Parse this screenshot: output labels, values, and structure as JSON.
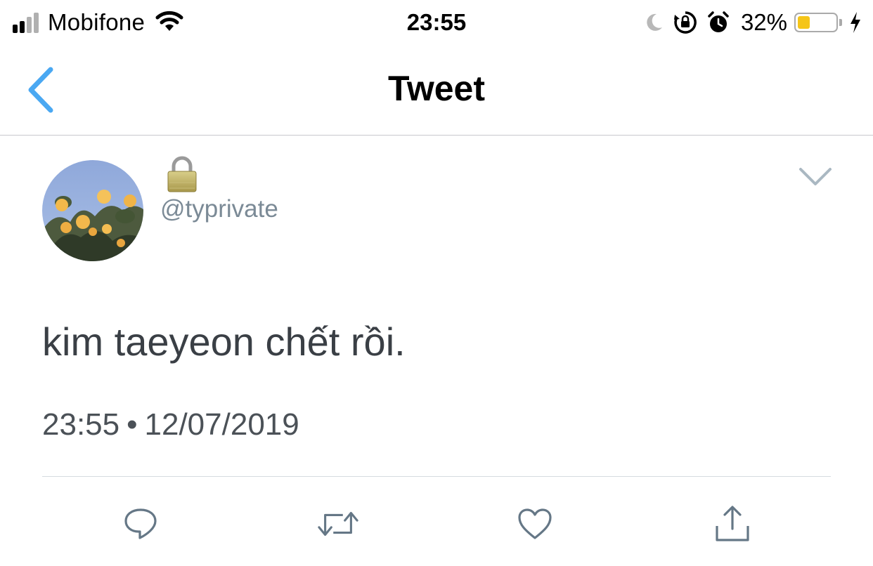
{
  "status_bar": {
    "carrier": "Mobifone",
    "time": "23:55",
    "battery_percent_label": "32%",
    "battery_level": 0.32,
    "icons": [
      "signal-icon",
      "wifi-icon",
      "moon-icon",
      "rotation-lock-icon",
      "alarm-icon",
      "battery-icon",
      "charging-icon"
    ]
  },
  "nav": {
    "title": "Tweet",
    "back_icon": "chevron-left-icon"
  },
  "tweet": {
    "handle": "@typrivate",
    "text": "kim taeyeon chết rồi.",
    "time": "23:55",
    "separator": "•",
    "date": "12/07/2019",
    "icons": [
      "lock-icon",
      "chevron-down-icon"
    ]
  },
  "actions": [
    {
      "name": "reply",
      "icon": "reply-icon"
    },
    {
      "name": "retweet",
      "icon": "retweet-icon"
    },
    {
      "name": "like",
      "icon": "heart-icon"
    },
    {
      "name": "share",
      "icon": "share-icon"
    }
  ],
  "colors": {
    "accent": "#4aa8f2",
    "icon_gray": "#657786",
    "battery_fill": "#f5c518",
    "handle_gray": "#7b8a96"
  }
}
